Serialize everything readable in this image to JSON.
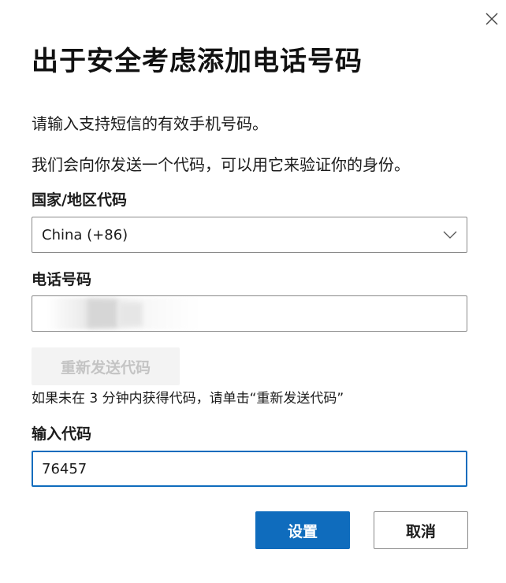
{
  "dialog": {
    "title": "出于安全考虑添加电话号码",
    "description_1": "请输入支持短信的有效手机号码。",
    "description_2": "我们会向你发送一个代码，可以用它来验证你的身份。"
  },
  "country": {
    "label": "国家/地区代码",
    "selected": "China (+86)",
    "icon": "chevron-down-icon"
  },
  "phone": {
    "label": "电话号码",
    "value_redacted": true
  },
  "resend": {
    "label": "重新发送代码",
    "disabled": true,
    "hint": "如果未在 3 分钟内获得代码，请单击“重新发送代码”"
  },
  "code": {
    "label": "输入代码",
    "value": "76457"
  },
  "actions": {
    "submit_label": "设置",
    "cancel_label": "取消"
  },
  "colors": {
    "accent": "#0f6cbd",
    "disabled_bg": "#f3f3f3",
    "disabled_text": "#c4c4c4",
    "border": "#8a8a8a"
  },
  "icons": {
    "close": "close-icon"
  }
}
